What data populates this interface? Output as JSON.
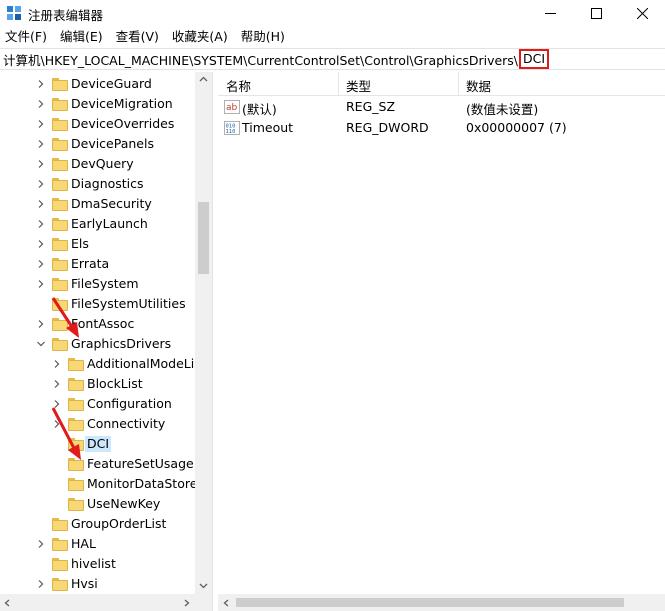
{
  "window": {
    "title": "注册表编辑器"
  },
  "menu": [
    {
      "label": "文件(F)"
    },
    {
      "label": "编辑(E)"
    },
    {
      "label": "查看(V)"
    },
    {
      "label": "收藏夹(A)"
    },
    {
      "label": "帮助(H)"
    }
  ],
  "address": {
    "path": "计算机\\HKEY_LOCAL_MACHINE\\SYSTEM\\CurrentControlSet\\Control\\GraphicsDrivers\\",
    "current": "DCI",
    "highlight_color": "#e11a1a"
  },
  "tree": {
    "items": [
      {
        "label": "DeviceGuard"
      },
      {
        "label": "DeviceMigration"
      },
      {
        "label": "DeviceOverrides"
      },
      {
        "label": "DevicePanels"
      },
      {
        "label": "DevQuery"
      },
      {
        "label": "Diagnostics"
      },
      {
        "label": "DmaSecurity"
      },
      {
        "label": "EarlyLaunch"
      },
      {
        "label": "Els"
      },
      {
        "label": "Errata"
      },
      {
        "label": "FileSystem"
      },
      {
        "label": "FileSystemUtilities"
      },
      {
        "label": "FontAssoc"
      },
      {
        "label": "GraphicsDrivers"
      },
      {
        "label": "AdditionalModeLists"
      },
      {
        "label": "BlockList"
      },
      {
        "label": "Configuration"
      },
      {
        "label": "Connectivity"
      },
      {
        "label": "DCI"
      },
      {
        "label": "FeatureSetUsage"
      },
      {
        "label": "MonitorDataStore"
      },
      {
        "label": "UseNewKey"
      },
      {
        "label": "GroupOrderList"
      },
      {
        "label": "HAL"
      },
      {
        "label": "hivelist"
      },
      {
        "label": "Hvsi"
      }
    ]
  },
  "list": {
    "columns": {
      "name": "名称",
      "type": "类型",
      "data": "数据"
    },
    "rows": [
      {
        "name": "(默认)",
        "type": "REG_SZ",
        "data": "(数值未设置)",
        "icon": "string-value-icon"
      },
      {
        "name": "Timeout",
        "type": "REG_DWORD",
        "data": "0x00000007 (7)",
        "icon": "binary-value-icon"
      }
    ]
  },
  "colors": {
    "selection": "#cce8ff",
    "arrow": "#e11a1a",
    "folder": "#f8d775"
  }
}
